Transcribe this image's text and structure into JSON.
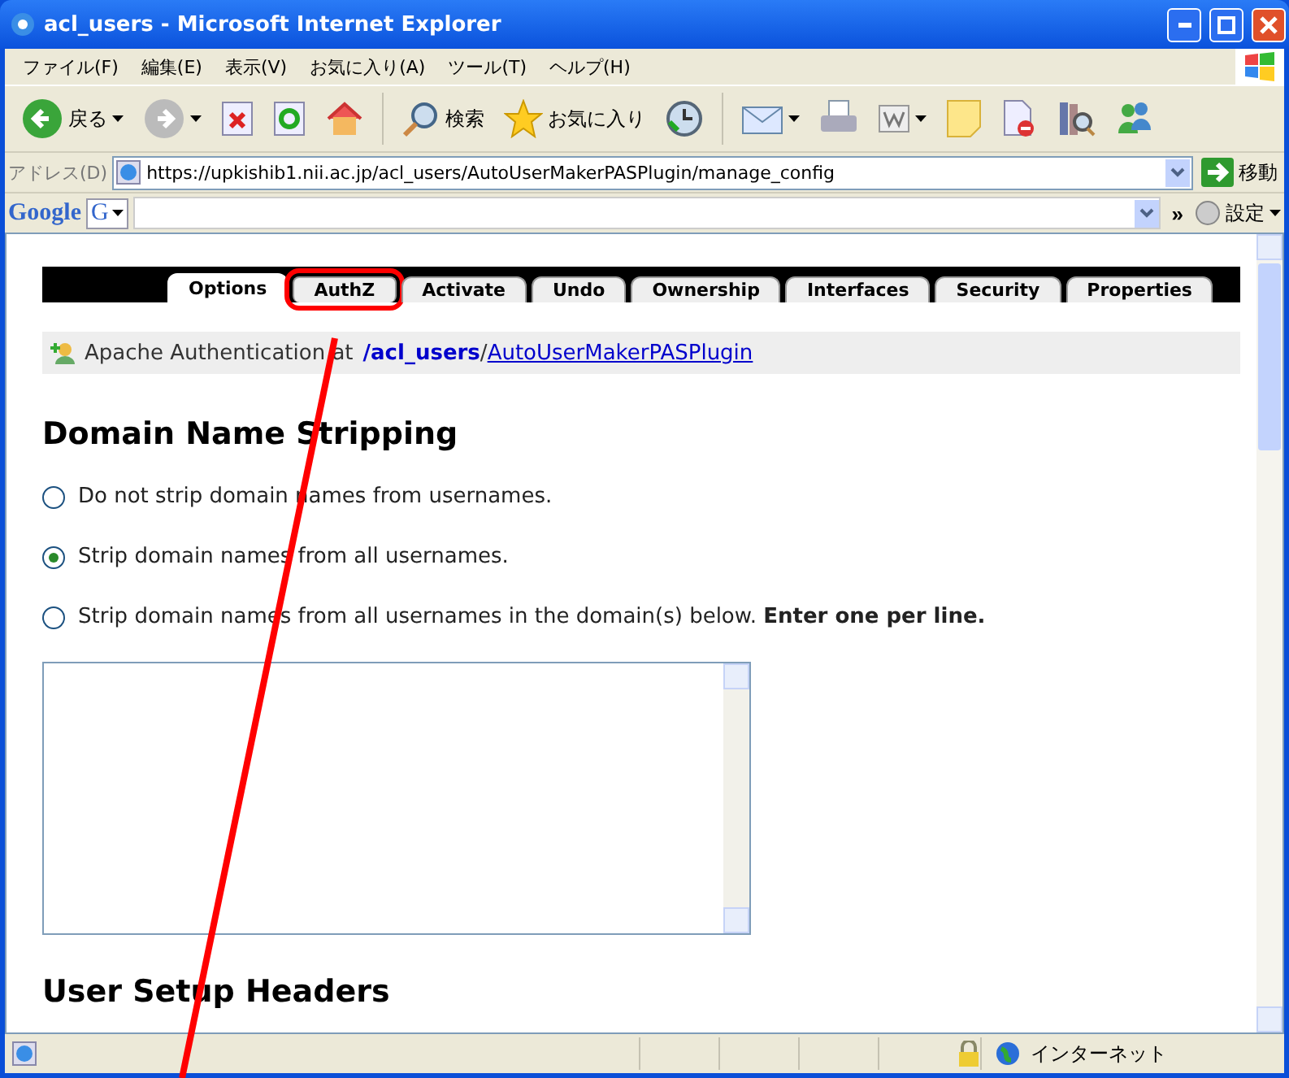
{
  "window": {
    "title": "acl_users - Microsoft Internet Explorer"
  },
  "menu": [
    "ファイル(F)",
    "編集(E)",
    "表示(V)",
    "お気に入り(A)",
    "ツール(T)",
    "ヘルプ(H)"
  ],
  "toolbar": [
    {
      "kind": "back",
      "label": "戻る",
      "dropdown": true
    },
    {
      "kind": "forward",
      "dropdown": true
    },
    {
      "kind": "stop"
    },
    {
      "kind": "refresh"
    },
    {
      "kind": "home"
    },
    {
      "kind": "sep"
    },
    {
      "kind": "search",
      "label": "検索"
    },
    {
      "kind": "favorites",
      "label": "お気に入り"
    },
    {
      "kind": "history"
    },
    {
      "kind": "sep"
    },
    {
      "kind": "mail",
      "dropdown": true
    },
    {
      "kind": "print"
    },
    {
      "kind": "word",
      "dropdown": true
    },
    {
      "kind": "note"
    },
    {
      "kind": "blocked"
    },
    {
      "kind": "research"
    },
    {
      "kind": "messenger"
    }
  ],
  "address_bar": {
    "label": "アドレス(D)",
    "value": "https://upkishib1.nii.ac.jp/acl_users/AutoUserMakerPASPlugin/manage_config",
    "go": "移動"
  },
  "google_toolbar": {
    "logo": "Google",
    "g_button": "G",
    "more": "»",
    "settings": "設定"
  },
  "tabs": [
    {
      "label": "Options",
      "selected": true,
      "highlighted": false
    },
    {
      "label": "AuthZ",
      "selected": false,
      "highlighted": true
    },
    {
      "label": "Activate",
      "selected": false,
      "highlighted": false
    },
    {
      "label": "Undo",
      "selected": false,
      "highlighted": false
    },
    {
      "label": "Ownership",
      "selected": false,
      "highlighted": false
    },
    {
      "label": "Interfaces",
      "selected": false,
      "highlighted": false
    },
    {
      "label": "Security",
      "selected": false,
      "highlighted": false
    },
    {
      "label": "Properties",
      "selected": false,
      "highlighted": false
    }
  ],
  "breadcrumb": {
    "prefix": "Apache Authentication at",
    "path": "/acl_users",
    "separator": "/",
    "link": "AutoUserMakerPASPlugin"
  },
  "heading": "Domain Name Stripping",
  "options": [
    {
      "label": "Do not strip domain names from usernames.",
      "selected": false
    },
    {
      "label": "Strip domain names from all usernames.",
      "selected": true
    },
    {
      "label": "Strip domain names from all usernames in the domain(s) below. **Enter one per line.**",
      "selected": false
    }
  ],
  "subheading": "User Setup Headers",
  "status_bar": {
    "zone": "インターネット"
  }
}
